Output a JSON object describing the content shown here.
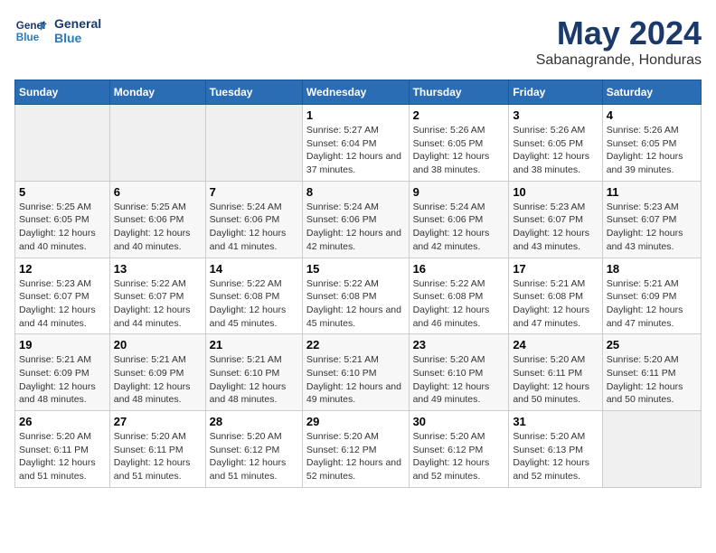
{
  "logo": {
    "line1": "General",
    "line2": "Blue"
  },
  "title": "May 2024",
  "subtitle": "Sabanagrande, Honduras",
  "headers": [
    "Sunday",
    "Monday",
    "Tuesday",
    "Wednesday",
    "Thursday",
    "Friday",
    "Saturday"
  ],
  "weeks": [
    [
      {
        "num": "",
        "sunrise": "",
        "sunset": "",
        "daylight": "",
        "empty": true
      },
      {
        "num": "",
        "sunrise": "",
        "sunset": "",
        "daylight": "",
        "empty": true
      },
      {
        "num": "",
        "sunrise": "",
        "sunset": "",
        "daylight": "",
        "empty": true
      },
      {
        "num": "1",
        "sunrise": "Sunrise: 5:27 AM",
        "sunset": "Sunset: 6:04 PM",
        "daylight": "Daylight: 12 hours and 37 minutes.",
        "empty": false
      },
      {
        "num": "2",
        "sunrise": "Sunrise: 5:26 AM",
        "sunset": "Sunset: 6:05 PM",
        "daylight": "Daylight: 12 hours and 38 minutes.",
        "empty": false
      },
      {
        "num": "3",
        "sunrise": "Sunrise: 5:26 AM",
        "sunset": "Sunset: 6:05 PM",
        "daylight": "Daylight: 12 hours and 38 minutes.",
        "empty": false
      },
      {
        "num": "4",
        "sunrise": "Sunrise: 5:26 AM",
        "sunset": "Sunset: 6:05 PM",
        "daylight": "Daylight: 12 hours and 39 minutes.",
        "empty": false
      }
    ],
    [
      {
        "num": "5",
        "sunrise": "Sunrise: 5:25 AM",
        "sunset": "Sunset: 6:05 PM",
        "daylight": "Daylight: 12 hours and 40 minutes.",
        "empty": false
      },
      {
        "num": "6",
        "sunrise": "Sunrise: 5:25 AM",
        "sunset": "Sunset: 6:06 PM",
        "daylight": "Daylight: 12 hours and 40 minutes.",
        "empty": false
      },
      {
        "num": "7",
        "sunrise": "Sunrise: 5:24 AM",
        "sunset": "Sunset: 6:06 PM",
        "daylight": "Daylight: 12 hours and 41 minutes.",
        "empty": false
      },
      {
        "num": "8",
        "sunrise": "Sunrise: 5:24 AM",
        "sunset": "Sunset: 6:06 PM",
        "daylight": "Daylight: 12 hours and 42 minutes.",
        "empty": false
      },
      {
        "num": "9",
        "sunrise": "Sunrise: 5:24 AM",
        "sunset": "Sunset: 6:06 PM",
        "daylight": "Daylight: 12 hours and 42 minutes.",
        "empty": false
      },
      {
        "num": "10",
        "sunrise": "Sunrise: 5:23 AM",
        "sunset": "Sunset: 6:07 PM",
        "daylight": "Daylight: 12 hours and 43 minutes.",
        "empty": false
      },
      {
        "num": "11",
        "sunrise": "Sunrise: 5:23 AM",
        "sunset": "Sunset: 6:07 PM",
        "daylight": "Daylight: 12 hours and 43 minutes.",
        "empty": false
      }
    ],
    [
      {
        "num": "12",
        "sunrise": "Sunrise: 5:23 AM",
        "sunset": "Sunset: 6:07 PM",
        "daylight": "Daylight: 12 hours and 44 minutes.",
        "empty": false
      },
      {
        "num": "13",
        "sunrise": "Sunrise: 5:22 AM",
        "sunset": "Sunset: 6:07 PM",
        "daylight": "Daylight: 12 hours and 44 minutes.",
        "empty": false
      },
      {
        "num": "14",
        "sunrise": "Sunrise: 5:22 AM",
        "sunset": "Sunset: 6:08 PM",
        "daylight": "Daylight: 12 hours and 45 minutes.",
        "empty": false
      },
      {
        "num": "15",
        "sunrise": "Sunrise: 5:22 AM",
        "sunset": "Sunset: 6:08 PM",
        "daylight": "Daylight: 12 hours and 45 minutes.",
        "empty": false
      },
      {
        "num": "16",
        "sunrise": "Sunrise: 5:22 AM",
        "sunset": "Sunset: 6:08 PM",
        "daylight": "Daylight: 12 hours and 46 minutes.",
        "empty": false
      },
      {
        "num": "17",
        "sunrise": "Sunrise: 5:21 AM",
        "sunset": "Sunset: 6:08 PM",
        "daylight": "Daylight: 12 hours and 47 minutes.",
        "empty": false
      },
      {
        "num": "18",
        "sunrise": "Sunrise: 5:21 AM",
        "sunset": "Sunset: 6:09 PM",
        "daylight": "Daylight: 12 hours and 47 minutes.",
        "empty": false
      }
    ],
    [
      {
        "num": "19",
        "sunrise": "Sunrise: 5:21 AM",
        "sunset": "Sunset: 6:09 PM",
        "daylight": "Daylight: 12 hours and 48 minutes.",
        "empty": false
      },
      {
        "num": "20",
        "sunrise": "Sunrise: 5:21 AM",
        "sunset": "Sunset: 6:09 PM",
        "daylight": "Daylight: 12 hours and 48 minutes.",
        "empty": false
      },
      {
        "num": "21",
        "sunrise": "Sunrise: 5:21 AM",
        "sunset": "Sunset: 6:10 PM",
        "daylight": "Daylight: 12 hours and 48 minutes.",
        "empty": false
      },
      {
        "num": "22",
        "sunrise": "Sunrise: 5:21 AM",
        "sunset": "Sunset: 6:10 PM",
        "daylight": "Daylight: 12 hours and 49 minutes.",
        "empty": false
      },
      {
        "num": "23",
        "sunrise": "Sunrise: 5:20 AM",
        "sunset": "Sunset: 6:10 PM",
        "daylight": "Daylight: 12 hours and 49 minutes.",
        "empty": false
      },
      {
        "num": "24",
        "sunrise": "Sunrise: 5:20 AM",
        "sunset": "Sunset: 6:11 PM",
        "daylight": "Daylight: 12 hours and 50 minutes.",
        "empty": false
      },
      {
        "num": "25",
        "sunrise": "Sunrise: 5:20 AM",
        "sunset": "Sunset: 6:11 PM",
        "daylight": "Daylight: 12 hours and 50 minutes.",
        "empty": false
      }
    ],
    [
      {
        "num": "26",
        "sunrise": "Sunrise: 5:20 AM",
        "sunset": "Sunset: 6:11 PM",
        "daylight": "Daylight: 12 hours and 51 minutes.",
        "empty": false
      },
      {
        "num": "27",
        "sunrise": "Sunrise: 5:20 AM",
        "sunset": "Sunset: 6:11 PM",
        "daylight": "Daylight: 12 hours and 51 minutes.",
        "empty": false
      },
      {
        "num": "28",
        "sunrise": "Sunrise: 5:20 AM",
        "sunset": "Sunset: 6:12 PM",
        "daylight": "Daylight: 12 hours and 51 minutes.",
        "empty": false
      },
      {
        "num": "29",
        "sunrise": "Sunrise: 5:20 AM",
        "sunset": "Sunset: 6:12 PM",
        "daylight": "Daylight: 12 hours and 52 minutes.",
        "empty": false
      },
      {
        "num": "30",
        "sunrise": "Sunrise: 5:20 AM",
        "sunset": "Sunset: 6:12 PM",
        "daylight": "Daylight: 12 hours and 52 minutes.",
        "empty": false
      },
      {
        "num": "31",
        "sunrise": "Sunrise: 5:20 AM",
        "sunset": "Sunset: 6:13 PM",
        "daylight": "Daylight: 12 hours and 52 minutes.",
        "empty": false
      },
      {
        "num": "",
        "sunrise": "",
        "sunset": "",
        "daylight": "",
        "empty": true
      }
    ]
  ]
}
